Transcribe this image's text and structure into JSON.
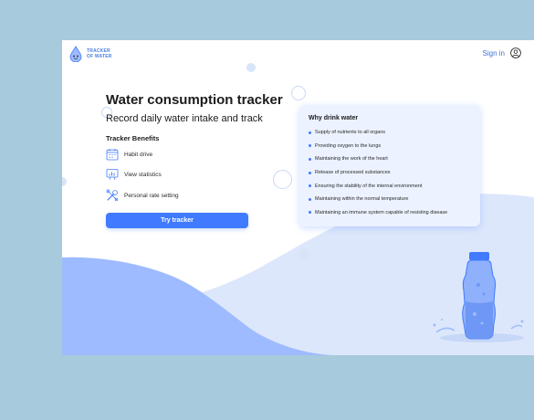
{
  "colors": {
    "background": "#a7cadc",
    "accent": "#407bff",
    "card_bg": "#ecf2ff",
    "wave_light": "#dde7fb",
    "wave_dark": "#9ebbff"
  },
  "header": {
    "logo": {
      "line1": "TRACKER",
      "line2": "OF WATER",
      "icon": "water-drop-logo-icon"
    },
    "signin_label": "Sign in",
    "user_icon": "user-circle-icon"
  },
  "hero": {
    "title": "Water consumption tracker",
    "subtitle": "Record daily water intake and track"
  },
  "benefits": {
    "title": "Tracker Benefits",
    "items": [
      {
        "label": "Habit drive",
        "icon": "calendar-icon"
      },
      {
        "label": "View statistics",
        "icon": "statistics-icon"
      },
      {
        "label": "Personal rate setting",
        "icon": "tools-icon"
      }
    ]
  },
  "cta": {
    "label": "Try tracker"
  },
  "why_card": {
    "title": "Why drink water",
    "items": [
      "Supply of nutrients to all organs",
      "Providing oxygen to the lungs",
      "Maintaining the work of the heart",
      "Release of processed substances",
      "Ensuring the stability of the internal environment",
      "Maintaining within the normal temperature",
      "Maintaining an immune system capable of resisting disease"
    ]
  },
  "illustration": {
    "icon": "water-bottle-icon"
  }
}
